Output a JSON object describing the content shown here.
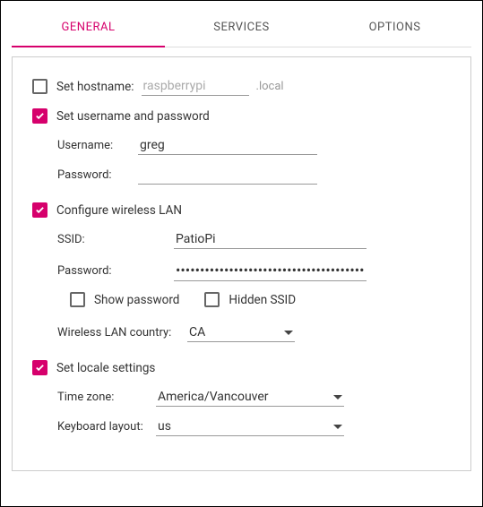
{
  "tabs": {
    "general": "GENERAL",
    "services": "SERVICES",
    "options": "OPTIONS"
  },
  "hostname": {
    "label": "Set hostname:",
    "placeholder": "raspberrypi",
    "suffix": ".local",
    "checked": false
  },
  "userpass": {
    "label": "Set username and password",
    "checked": true,
    "username_label": "Username:",
    "username_value": "greg",
    "password_label": "Password:",
    "password_value": ""
  },
  "wifi": {
    "label": "Configure wireless LAN",
    "checked": true,
    "ssid_label": "SSID:",
    "ssid_value": "PatioPi",
    "password_label": "Password:",
    "password_value": "••••••••••••••••••••••••••••••••••••••••",
    "show_password_label": "Show password",
    "show_password_checked": false,
    "hidden_ssid_label": "Hidden SSID",
    "hidden_ssid_checked": false,
    "country_label": "Wireless LAN country:",
    "country_value": "CA"
  },
  "locale": {
    "label": "Set locale settings",
    "checked": true,
    "tz_label": "Time zone:",
    "tz_value": "America/Vancouver",
    "kb_label": "Keyboard layout:",
    "kb_value": "us"
  }
}
